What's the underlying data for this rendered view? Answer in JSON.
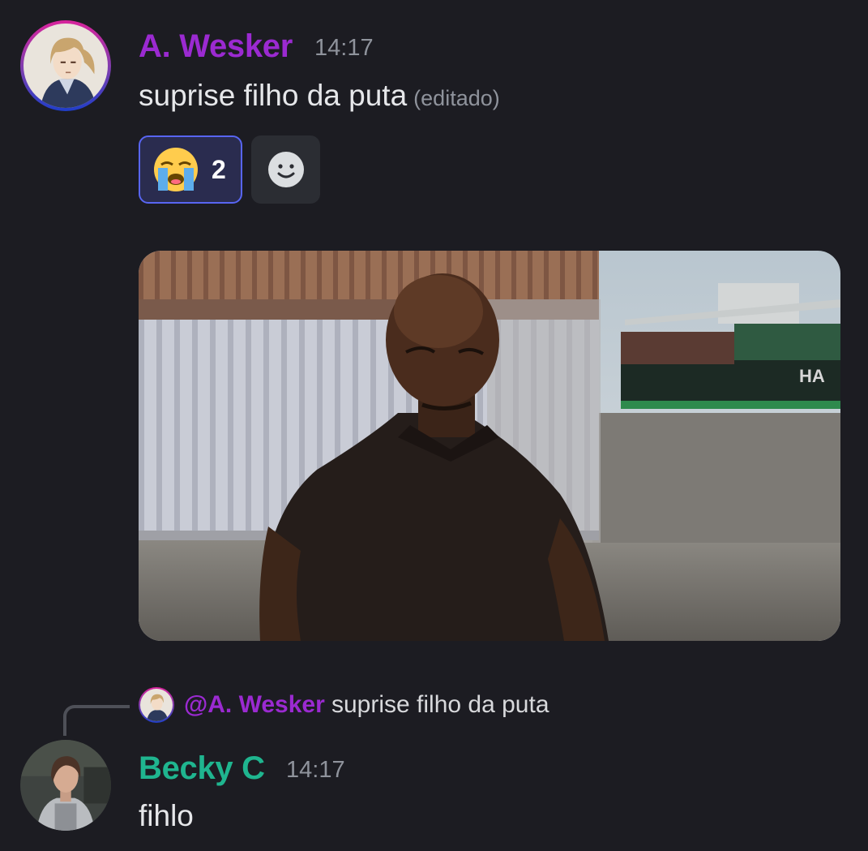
{
  "messages": [
    {
      "author": "A. Wesker",
      "author_color": "#9b2ad1",
      "time": "14:17",
      "text": "suprise filho da puta",
      "edited_label": "(editado)",
      "reactions": [
        {
          "emoji": "😭",
          "emoji_name": "loudly-crying-face",
          "count": "2",
          "active": true
        }
      ],
      "add_reaction_icon": "smiley-add-reaction-icon",
      "attachment": {
        "type": "gif",
        "description_icon": "gif-image"
      }
    },
    {
      "author": "Becky C",
      "author_color": "#1fb58f",
      "time": "14:17",
      "text": "fihlo",
      "reply_to": {
        "mention": "@A. Wesker",
        "text": "suprise filho da puta"
      }
    }
  ],
  "colors": {
    "background": "#1c1c22",
    "reaction_active_border": "#5865f2",
    "reaction_active_bg": "#2a2c4f",
    "muted_text": "#8f939c"
  }
}
